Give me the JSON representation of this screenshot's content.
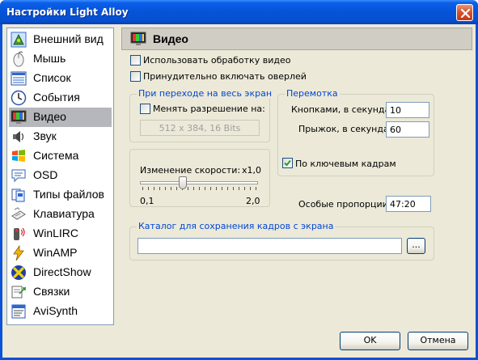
{
  "window": {
    "title": "Настройки Light Alloy"
  },
  "sidebar": {
    "items": [
      {
        "label": "Внешний вид",
        "icon": "appearance-icon"
      },
      {
        "label": "Мышь",
        "icon": "mouse-icon"
      },
      {
        "label": "Список",
        "icon": "list-icon"
      },
      {
        "label": "События",
        "icon": "clock-icon"
      },
      {
        "label": "Видео",
        "icon": "monitor-icon"
      },
      {
        "label": "Звук",
        "icon": "speaker-icon"
      },
      {
        "label": "Система",
        "icon": "windows-flag-icon"
      },
      {
        "label": "OSD",
        "icon": "osd-icon"
      },
      {
        "label": "Типы файлов",
        "icon": "file-types-icon"
      },
      {
        "label": "Клавиатура",
        "icon": "keyboard-icon"
      },
      {
        "label": "WinLIRC",
        "icon": "remote-icon"
      },
      {
        "label": "WinAMP",
        "icon": "winamp-icon"
      },
      {
        "label": "DirectShow",
        "icon": "directshow-icon"
      },
      {
        "label": "Связки",
        "icon": "links-icon"
      },
      {
        "label": "AviSynth",
        "icon": "avisynth-icon"
      }
    ],
    "selected_index": 4
  },
  "header": {
    "title": "Видео"
  },
  "video": {
    "use_processing": {
      "label": "Использовать обработку видео",
      "checked": false
    },
    "force_overlay": {
      "label": "Принудительно включать оверлей",
      "checked": false
    },
    "fullscreen": {
      "group_label": "При переходе на весь экран",
      "change_res": {
        "label": "Менять разрешение на:",
        "checked": false
      },
      "resolution_value": "512 x 384, 16 Bits"
    },
    "speed": {
      "label": "Изменение скорости:",
      "value_text": "x1,0",
      "min_label": "0,1",
      "max_label": "2,0",
      "position": 0.35
    },
    "rewind": {
      "group_label": "Перемотка",
      "buttons_label": "Кнопками, в секундах",
      "buttons_value": "10",
      "jump_label": "Прыжок, в секундах",
      "jump_value": "60",
      "keyframes": {
        "label": "По ключевым кадрам",
        "checked": true
      }
    },
    "aspect": {
      "label": "Особые пропорции",
      "value": "47:20"
    },
    "capture": {
      "group_label": "Каталог для сохранения кадров с экрана",
      "path_value": "",
      "browse_label": "..."
    }
  },
  "footer": {
    "ok_label": "OK",
    "cancel_label": "Отмена"
  }
}
